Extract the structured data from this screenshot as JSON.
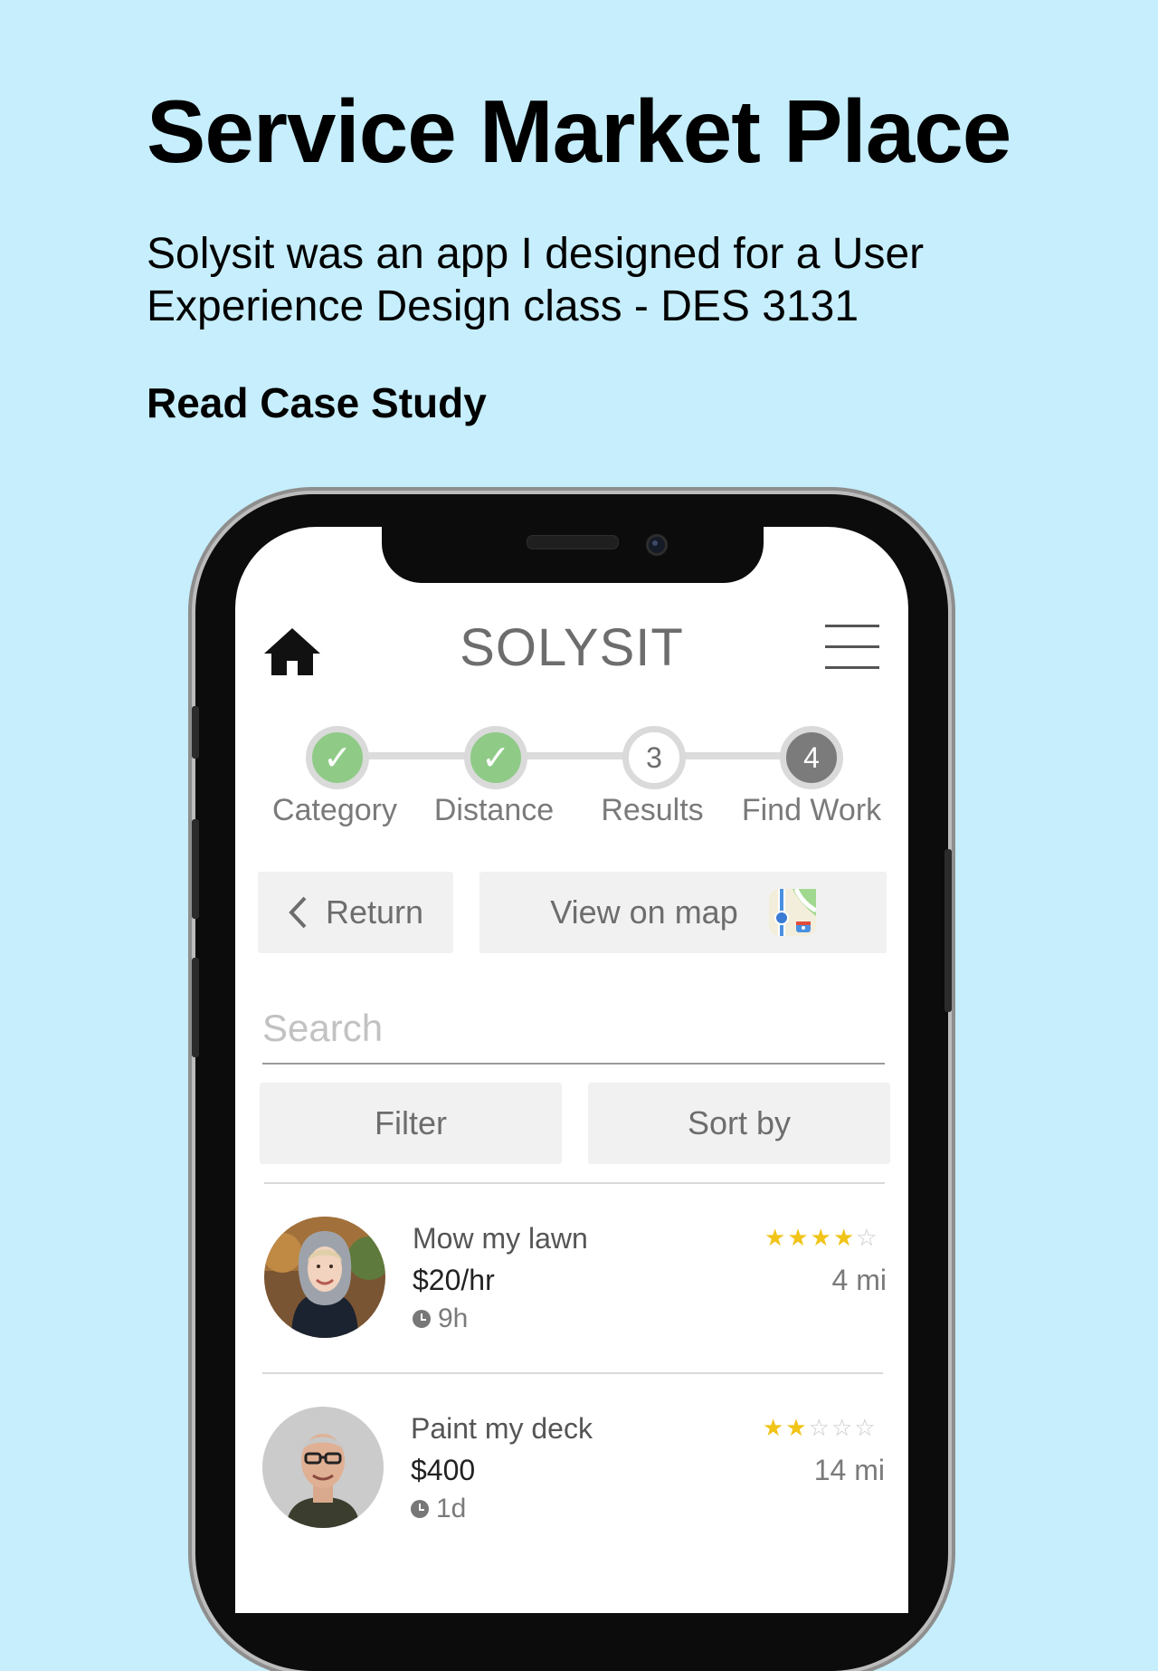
{
  "header": {
    "title": "Service Market Place",
    "description": "Solysit was an app I designed for a User Experience Design class - DES 3131",
    "cta_label": "Read Case Study"
  },
  "app": {
    "brand": "SOLYSIT",
    "steps": [
      {
        "label": "Category",
        "state": "done",
        "mark": "✓"
      },
      {
        "label": "Distance",
        "state": "done",
        "mark": "✓"
      },
      {
        "label": "Results",
        "state": "current",
        "mark": "3"
      },
      {
        "label": "Find Work",
        "state": "next",
        "mark": "4"
      }
    ],
    "return_label": "Return",
    "map_label": "View on map",
    "search_placeholder": "Search",
    "filter_label": "Filter",
    "sort_label": "Sort by",
    "listings": [
      {
        "title": "Mow my lawn",
        "price": "$20/hr",
        "time": "9h",
        "rating": 4,
        "max_rating": 5,
        "distance": "4 mi"
      },
      {
        "title": "Paint my deck",
        "price": "$400",
        "time": "1d",
        "rating": 2,
        "max_rating": 5,
        "distance": "14 mi"
      }
    ]
  },
  "colors": {
    "background": "#c6eefc",
    "step_done": "#8fcb87",
    "star": "#f0c419"
  }
}
